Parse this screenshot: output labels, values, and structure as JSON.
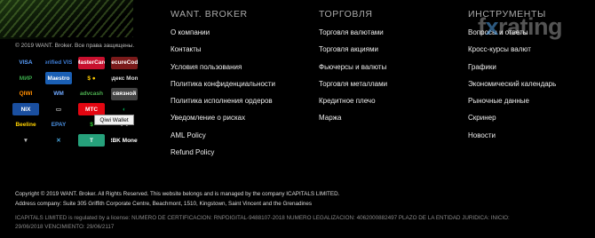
{
  "brand": {
    "copyright_small": "© 2019 WANT. Broker. Все права защищены."
  },
  "payments": [
    {
      "name": "visa-logo",
      "label": "VISA",
      "color": "#5aa0ff",
      "bg": "transparent"
    },
    {
      "name": "verified-by-visa-logo",
      "label": "Verified VISA",
      "color": "#3d7dd6",
      "bg": "transparent"
    },
    {
      "name": "mastercard-logo",
      "label": "MasterCard",
      "color": "#fff",
      "bg": "#c8102e"
    },
    {
      "name": "mastercard-securecode-logo",
      "label": "SecureCode",
      "color": "#fff",
      "bg": "#7a1a1a"
    },
    {
      "name": "mir-logo",
      "label": "МИР",
      "color": "#3aa84a",
      "bg": "transparent"
    },
    {
      "name": "maestro-logo",
      "label": "Maestro",
      "color": "#fff",
      "bg": "#1a5fb4"
    },
    {
      "name": "yandex-money-logo",
      "label": "$ ●",
      "color": "#ffcc00",
      "bg": "transparent"
    },
    {
      "name": "yandex-money-text-logo",
      "label": "Яндекс Money",
      "color": "#ddd",
      "bg": "transparent"
    },
    {
      "name": "qiwi-logo",
      "label": "QIWI",
      "color": "#ff8c00",
      "bg": "transparent"
    },
    {
      "name": "webmoney-logo",
      "label": "WM",
      "color": "#6fa8ff",
      "bg": "transparent"
    },
    {
      "name": "advcash-logo",
      "label": "advcash",
      "color": "#4caf50",
      "bg": "transparent"
    },
    {
      "name": "svyaznoy-logo",
      "label": "связной",
      "color": "#fff",
      "bg": "#444"
    },
    {
      "name": "nix-money-logo",
      "label": "NIX",
      "color": "#fff",
      "bg": "#1a4fa0"
    },
    {
      "name": "bank-card-logo",
      "label": "▭",
      "color": "#bbb",
      "bg": "transparent"
    },
    {
      "name": "mts-logo",
      "label": "МТС",
      "color": "#fff",
      "bg": "#e30611"
    },
    {
      "name": "megafon-logo",
      "label": "◐",
      "color": "#00a650",
      "bg": "transparent"
    },
    {
      "name": "beeline-logo",
      "label": "Beeline",
      "color": "#ffd200",
      "bg": "transparent"
    },
    {
      "name": "epay-logo",
      "label": "EPAY",
      "color": "#4a8fe0",
      "bg": "transparent"
    },
    {
      "name": "green-cash-logo",
      "label": "$",
      "color": "#3c3",
      "bg": "transparent"
    },
    {
      "name": "tele2-logo",
      "label": "● ●",
      "color": "#fff",
      "bg": "transparent"
    },
    {
      "name": "tron-logo",
      "label": "▼",
      "color": "#bbb",
      "bg": "transparent"
    },
    {
      "name": "ripple-logo",
      "label": "✕",
      "color": "#4aa8e0",
      "bg": "transparent"
    },
    {
      "name": "tether-logo",
      "label": "T",
      "color": "#fff",
      "bg": "#26a17b"
    },
    {
      "name": "rbk-money-logo",
      "label": "RBK Money",
      "color": "#fff",
      "bg": "transparent"
    }
  ],
  "tooltip": "Qiwi Wallet",
  "columns": [
    {
      "heading": "WANT. BROKER",
      "items": [
        "О компании",
        "Контакты",
        "Условия пользования",
        "Политика конфиденциальности",
        "Политика исполнения ордеров",
        "Уведомление о рисках",
        "AML Policy",
        "Refund Policy"
      ]
    },
    {
      "heading": "ТОРГОВЛЯ",
      "items": [
        "Торговля валютами",
        "Торговля акциями",
        "Фьючерсы и валюты",
        "Торговля металлами",
        "Кредитное плечо",
        "Маржа"
      ]
    },
    {
      "heading": "ИНСТРУМЕНТЫ",
      "items": [
        "Вопросы и ответы",
        "Кросс-курсы валют",
        "Графики",
        "Экономический календарь",
        "Рыночные данные",
        "Скринер",
        "Новости"
      ]
    }
  ],
  "watermark": {
    "prefix": "f",
    "x": "x",
    "suffix": "rating"
  },
  "legal": {
    "line1": "Copyright © 2019 WANT. Broker. All Rights Reserved. This website belongs and is managed by the company ICAPITALS LIMITED.",
    "line2": "Address company: Suite 305 Griffith Corporate Centre, Beachmont, 1510, Kingstown, Saint Vincent and the Grenadines",
    "line3": "ICAPITALS LIMITED is regulated by a license: NUMERO DE CERTIFICACION: RNPDIGITAL-9488107-2018 NUMERO LEGALIZACION: 4062000882497 PLAZO DE LA ENTIDAD JURIDICA: INICIO:",
    "line4": "29/06/2018 VENCIMIENTO: 29/06/2117"
  }
}
